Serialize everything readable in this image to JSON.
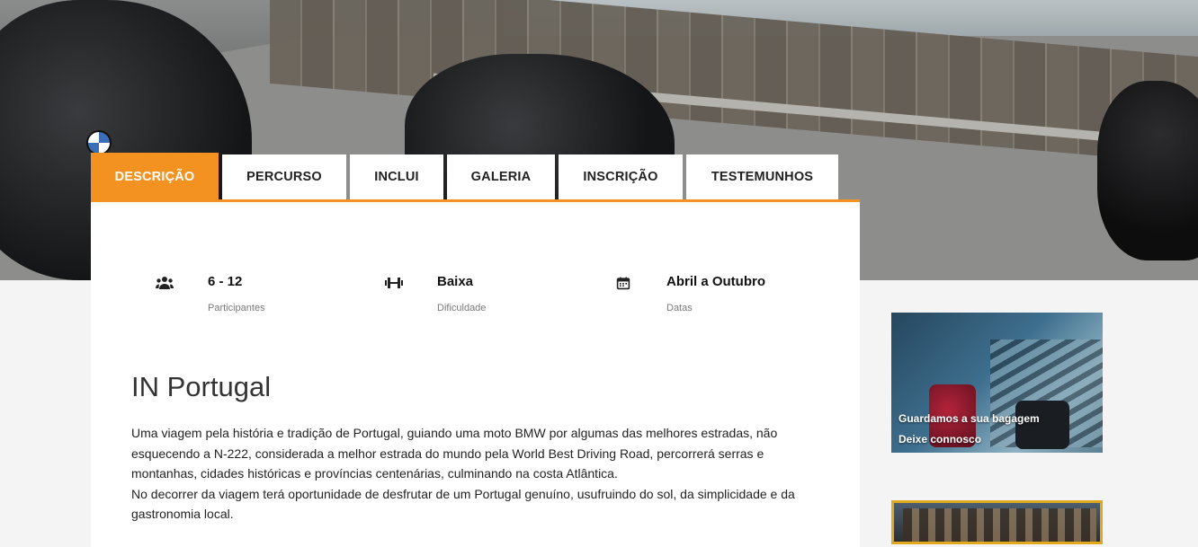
{
  "tabs": [
    {
      "label": "DESCRIÇÃO",
      "active": true
    },
    {
      "label": "PERCURSO",
      "active": false
    },
    {
      "label": "INCLUI",
      "active": false
    },
    {
      "label": "GALERIA",
      "active": false
    },
    {
      "label": "INSCRIÇÃO",
      "active": false
    },
    {
      "label": "TESTEMUNHOS",
      "active": false
    }
  ],
  "info": [
    {
      "icon": "users-icon",
      "value": "6 - 12",
      "label": "Participantes"
    },
    {
      "icon": "dumbbell-icon",
      "value": "Baixa",
      "label": "Dificuldade"
    },
    {
      "icon": "calendar-icon",
      "value": "Abril a Outubro",
      "label": "Datas"
    }
  ],
  "title": "IN Portugal",
  "description": {
    "p1": "Uma viagem pela história e tradição de Portugal, guiando uma moto BMW por algumas das melhores estradas, não esquecendo a N-222, considerada a melhor estrada do mundo pela World Best Driving Road, percorrerá serras e montanhas, cidades históricas e províncias centenárias, culminando na costa Atlântica.",
    "p2": "No decorrer da viagem terá oportunidade de desfrutar de um Portugal genuíno, usufruindo do sol, da simplicidade e da gastronomia local."
  },
  "sidebar": {
    "promo1": {
      "line1": "Guardamos a sua bagagem",
      "line2": "Deixe connosco"
    }
  },
  "colors": {
    "accent": "#f39221",
    "promo_border": "#e0a81c"
  }
}
